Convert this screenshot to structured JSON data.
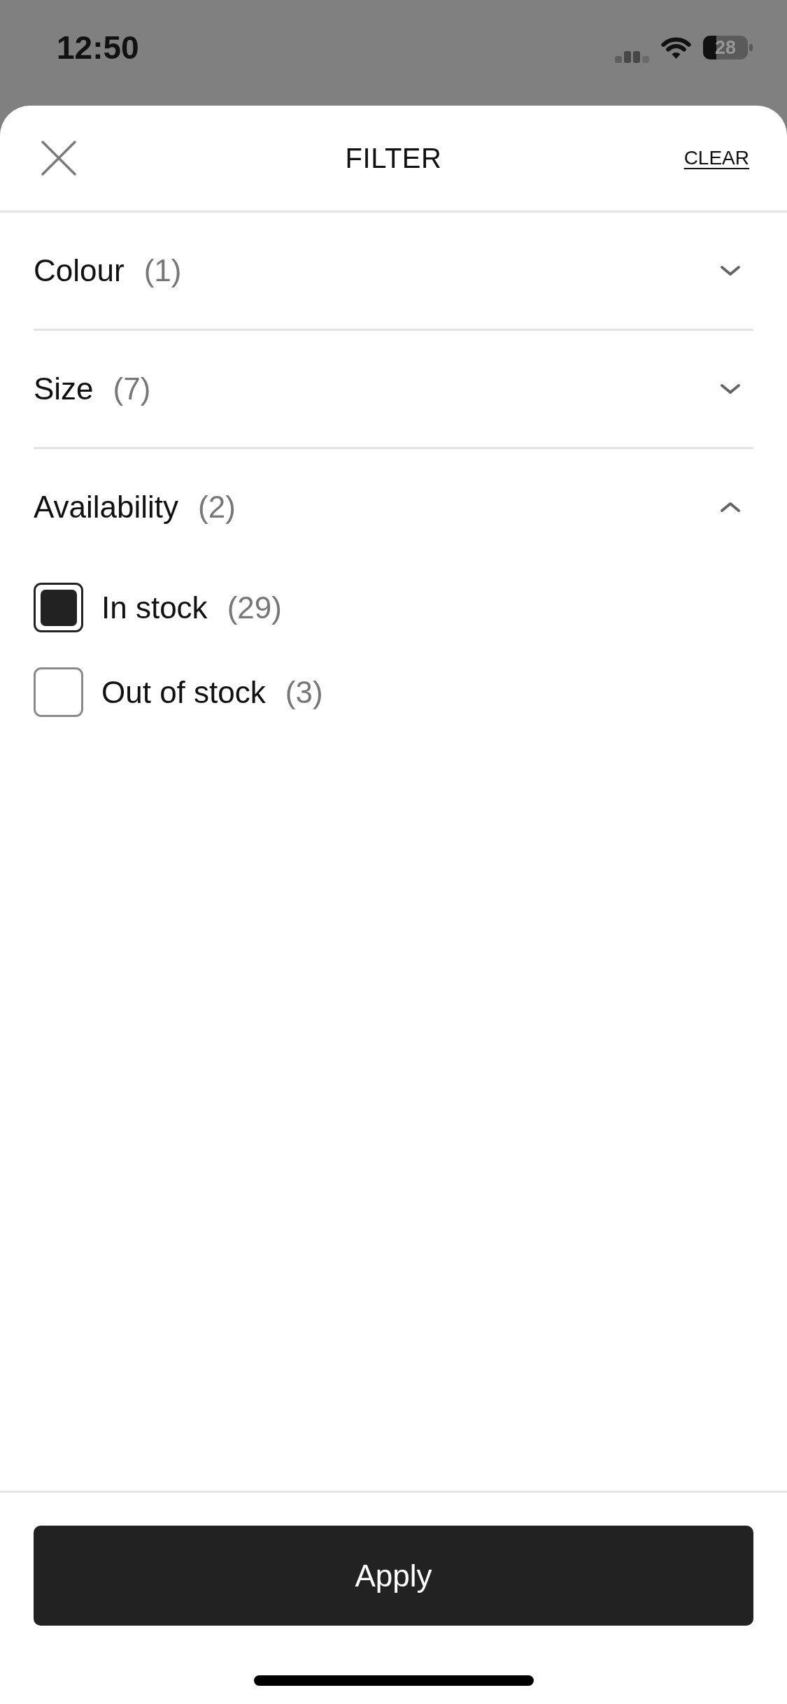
{
  "status_bar": {
    "time": "12:50",
    "battery": "28"
  },
  "header": {
    "title": "FILTER",
    "clear": "CLEAR"
  },
  "sections": [
    {
      "title": "Colour",
      "count": "(1)",
      "expanded": false
    },
    {
      "title": "Size",
      "count": "(7)",
      "expanded": false
    },
    {
      "title": "Availability",
      "count": "(2)",
      "expanded": true,
      "options": [
        {
          "label": "In stock",
          "count": "(29)",
          "checked": true
        },
        {
          "label": "Out of stock",
          "count": "(3)",
          "checked": false
        }
      ]
    }
  ],
  "apply_button": {
    "label": "Apply"
  }
}
